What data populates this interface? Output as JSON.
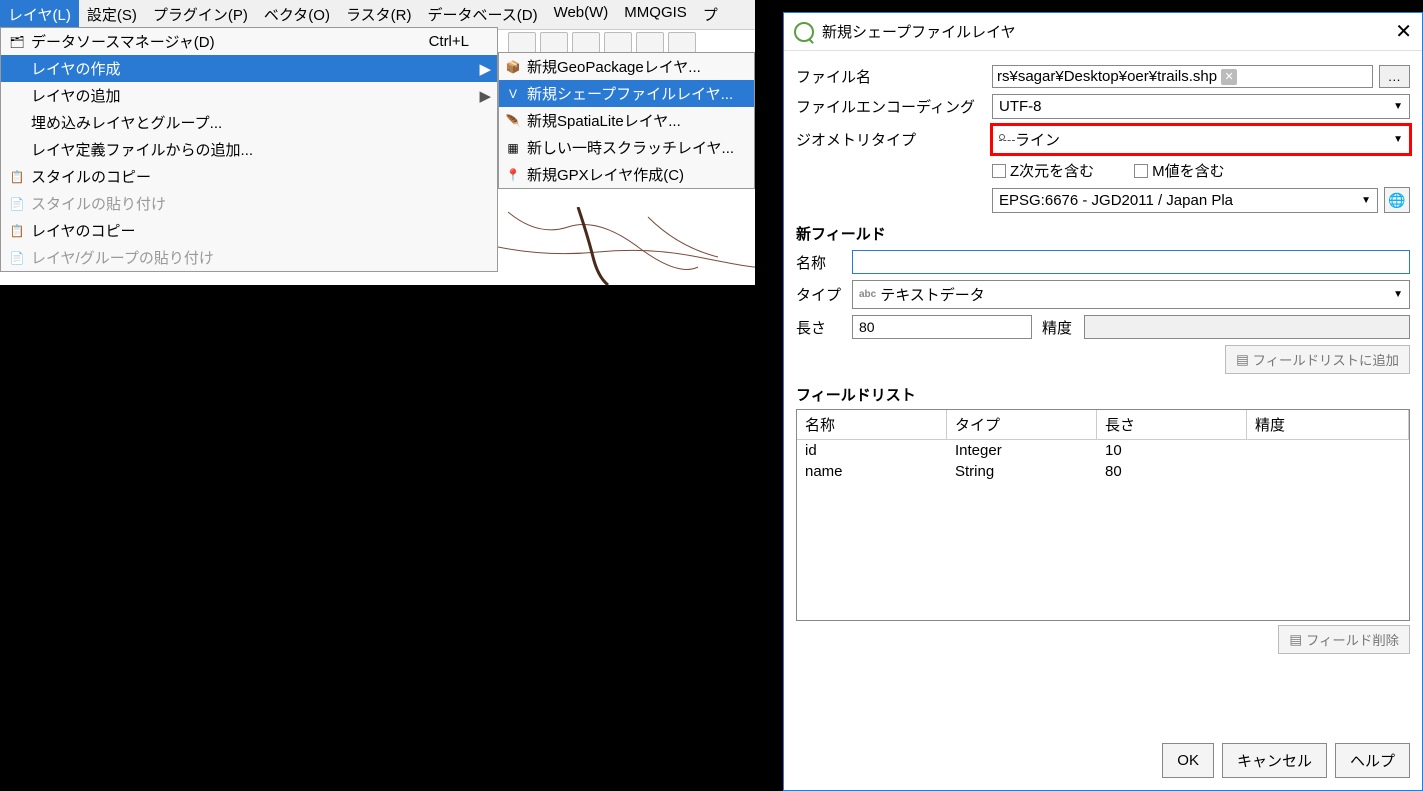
{
  "menubar": {
    "layer": "レイヤ(L)",
    "settings": "設定(S)",
    "plugins": "プラグイン(P)",
    "vector": "ベクタ(O)",
    "raster": "ラスタ(R)",
    "database": "データベース(D)",
    "web": "Web(W)",
    "mmqgis": "MMQGIS",
    "processing_frag": "プ"
  },
  "dropdown": {
    "datasource_manager": "データソースマネージャ(D)",
    "datasource_shortcut": "Ctrl+L",
    "create_layer": "レイヤの作成",
    "add_layer": "レイヤの追加",
    "embed_layers": "埋め込みレイヤとグループ...",
    "add_from_def": "レイヤ定義ファイルからの追加...",
    "copy_style": "スタイルのコピー",
    "paste_style": "スタイルの貼り付け",
    "copy_layer": "レイヤのコピー",
    "paste_layer": "レイヤ/グループの貼り付け"
  },
  "submenu": {
    "geopackage": "新規GeoPackageレイヤ...",
    "shapefile": "新規シェープファイルレイヤ...",
    "spatialite": "新規SpatiaLiteレイヤ...",
    "scratch": "新しい一時スクラッチレイヤ...",
    "gpx": "新規GPXレイヤ作成(C)"
  },
  "dialog": {
    "title": "新規シェープファイルレイヤ",
    "filename_label": "ファイル名",
    "filename_value": "rs¥sagar¥Desktop¥oer¥trails.shp",
    "browse_btn": "…",
    "encoding_label": "ファイルエンコーディング",
    "encoding_value": "UTF-8",
    "geometry_label": "ジオメトリタイプ",
    "geometry_value": "ライン",
    "z_dim": "Z次元を含む",
    "m_value": "M値を含む",
    "crs_value": "EPSG:6676 - JGD2011 / Japan Pla",
    "new_field_h": "新フィールド",
    "name_label": "名称",
    "name_value": "",
    "type_label": "タイプ",
    "type_value": "テキストデータ",
    "length_label": "長さ",
    "length_value": "80",
    "precision_label": "精度",
    "add_field_btn": "フィールドリストに追加",
    "field_list_h": "フィールドリスト",
    "col_name": "名称",
    "col_type": "タイプ",
    "col_length": "長さ",
    "col_precision": "精度",
    "rows": [
      {
        "name": "id",
        "type": "Integer",
        "length": "10",
        "precision": ""
      },
      {
        "name": "name",
        "type": "String",
        "length": "80",
        "precision": ""
      }
    ],
    "remove_field_btn": "フィールド削除",
    "ok": "OK",
    "cancel": "キャンセル",
    "help": "ヘルプ"
  }
}
